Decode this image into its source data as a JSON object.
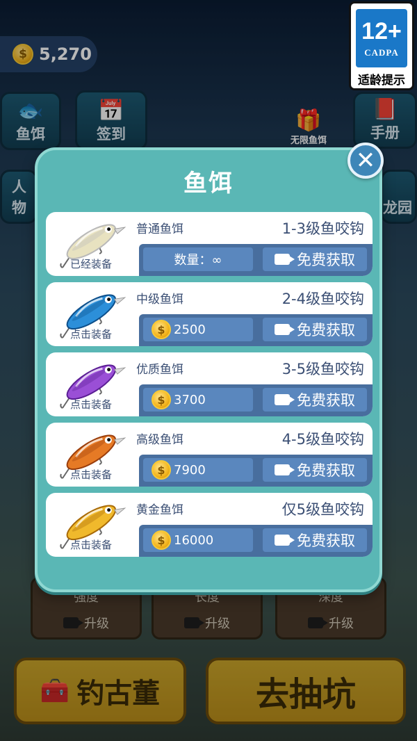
{
  "hud": {
    "coins": "5,270"
  },
  "rating": {
    "age": "12+",
    "org": "CADPA",
    "tip": "适龄提示"
  },
  "background": {
    "menu_bait": "鱼饵",
    "menu_checkin": "签到",
    "menu_unlimited_bait": "无限鱼饵",
    "menu_handbook": "手册",
    "menu_character": "人物",
    "menu_dragon_garden": "龙园",
    "upgrades": [
      {
        "label": "强度",
        "action": "升级"
      },
      {
        "label": "长度",
        "action": "升级"
      },
      {
        "label": "深度",
        "action": "升级"
      }
    ],
    "btn_antiques": "钓古董",
    "btn_dig": "去抽坑"
  },
  "dialog": {
    "title": "鱼饵",
    "close_icon": "close-icon",
    "free_label": "免费获取",
    "baits": [
      {
        "name": "普通鱼饵",
        "range": "1-3级鱼咬钩",
        "status": "已经装备",
        "price": "数量：∞",
        "price_type": "quantity",
        "color": "#e8e2c0",
        "accent": "#b9b9b9"
      },
      {
        "name": "中级鱼饵",
        "range": "2-4级鱼咬钩",
        "status": "点击装备",
        "price": "2500",
        "price_type": "coins",
        "color": "#2c8fd9",
        "accent": "#0e4f8a"
      },
      {
        "name": "优质鱼饵",
        "range": "3-5级鱼咬钩",
        "status": "点击装备",
        "price": "3700",
        "price_type": "coins",
        "color": "#9a4fd6",
        "accent": "#5b1f94"
      },
      {
        "name": "高级鱼饵",
        "range": "4-5级鱼咬钩",
        "status": "点击装备",
        "price": "7900",
        "price_type": "coins",
        "color": "#e67a25",
        "accent": "#9a3e0c"
      },
      {
        "name": "黄金鱼饵",
        "range": "仅5级鱼咬钩",
        "status": "点击装备",
        "price": "16000",
        "price_type": "coins",
        "color": "#f0b92c",
        "accent": "#a86a08"
      }
    ]
  }
}
